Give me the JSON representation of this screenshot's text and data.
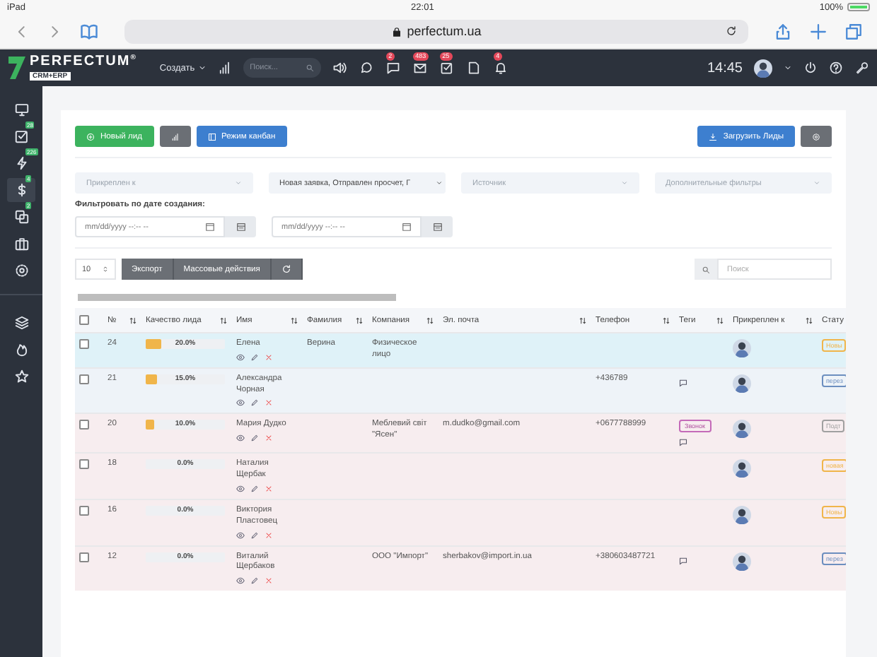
{
  "status_bar": {
    "device": "iPad",
    "time": "22:01",
    "battery": "100%"
  },
  "browser": {
    "url": "perfectum.ua"
  },
  "header": {
    "logo": "PERFECTUM",
    "logo_mark": "®",
    "logo_sub": "CRM+ERP",
    "create_menu": "Создать",
    "search": {
      "placeholder": "Поиск..."
    },
    "badges": [
      "2",
      "483",
      "25",
      "4"
    ],
    "clock": "14:45"
  },
  "sidebar": {
    "items": [
      {
        "selected": false
      },
      {
        "selected": false,
        "badge": "28"
      },
      {
        "selected": false,
        "badge": "226"
      },
      {
        "selected": true,
        "badge": "4"
      },
      {
        "selected": false,
        "badge": "2"
      },
      {
        "selected": false
      },
      {
        "selected": false
      },
      {
        "selected": false
      },
      {
        "selected": false
      },
      {
        "selected": false
      }
    ]
  },
  "actions": {
    "new_lead": "Новый лид",
    "kanban": "Режим канбан",
    "upload": "Загрузить Лиды"
  },
  "filters": [
    {
      "placeholder": "Прикреплен к"
    },
    {
      "value": "Новая заявка, Отправлен просчет, Г"
    },
    {
      "placeholder": "Источник"
    },
    {
      "placeholder": "Дополнительные фильтры"
    }
  ],
  "date_filter": {
    "label": "Фильтровать по дате создания:",
    "from": {
      "placeholder": "mm/dd/yyyy --:-- --"
    },
    "to": {
      "placeholder": "mm/dd/yyyy --:-- --"
    }
  },
  "table_tools": {
    "page_size": "10",
    "export": "Экспорт",
    "bulk": "Массовые действия",
    "search": {
      "placeholder": "Поиск"
    }
  },
  "table": {
    "select_all": {
      "checked": false
    },
    "columns": [
      "№",
      "Качество лида",
      "Имя",
      "Фамилия",
      "Компания",
      "Эл. почта",
      "Телефон",
      "Теги",
      "Прикреплен к",
      "Стату"
    ],
    "rows": [
      {
        "checked": false,
        "color": "#dff2f8",
        "id": "24",
        "quality": {
          "level": 0.2,
          "label": "20.0%"
        },
        "name": "Елена",
        "surname": "Верина",
        "company": "Физическое лицо",
        "has_comment": false,
        "status": {
          "text": "Новы",
          "color": "#f0b54a"
        }
      },
      {
        "checked": false,
        "color": "#eef3f8",
        "id": "21",
        "quality": {
          "level": 0.15,
          "label": "15.0%"
        },
        "name": "Александра Чорная",
        "phone": "+436789",
        "has_comment": true,
        "status": {
          "text": "перез",
          "color": "#6c8ebf"
        }
      },
      {
        "checked": false,
        "color": "#f7edef",
        "id": "20",
        "quality": {
          "level": 0.1,
          "label": "10.0%"
        },
        "name": "Мария Дудко",
        "company": "Меблевий світ \"Ясен\"",
        "email": "m.dudko@gmail.com",
        "phone": "+0677788999",
        "tags": [
          "Звонок"
        ],
        "has_comment": true,
        "status": {
          "text": "Подт",
          "color": "#a0a0a0"
        }
      },
      {
        "checked": false,
        "color": "#f7edef",
        "id": "18",
        "quality": {
          "level": 0,
          "label": "0.0%"
        },
        "name": "Наталия Щербак",
        "has_comment": false,
        "status": {
          "text": "новая",
          "color": "#f0b54a"
        }
      },
      {
        "checked": false,
        "color": "#f7edef",
        "id": "16",
        "quality": {
          "level": 0,
          "label": "0.0%"
        },
        "name": "Виктория Пластовец",
        "has_comment": false,
        "status": {
          "text": "Новы",
          "color": "#f0b54a"
        }
      },
      {
        "checked": false,
        "color": "#f7edef",
        "id": "12",
        "quality": {
          "level": 0,
          "label": "0.0%"
        },
        "name": "Виталий Щербаков",
        "company": "ООО \"Импорт\"",
        "email": "sherbakov@import.in.ua",
        "phone": "+380603487721",
        "has_comment": true,
        "status": {
          "text": "перез",
          "color": "#6c8ebf"
        }
      }
    ]
  }
}
